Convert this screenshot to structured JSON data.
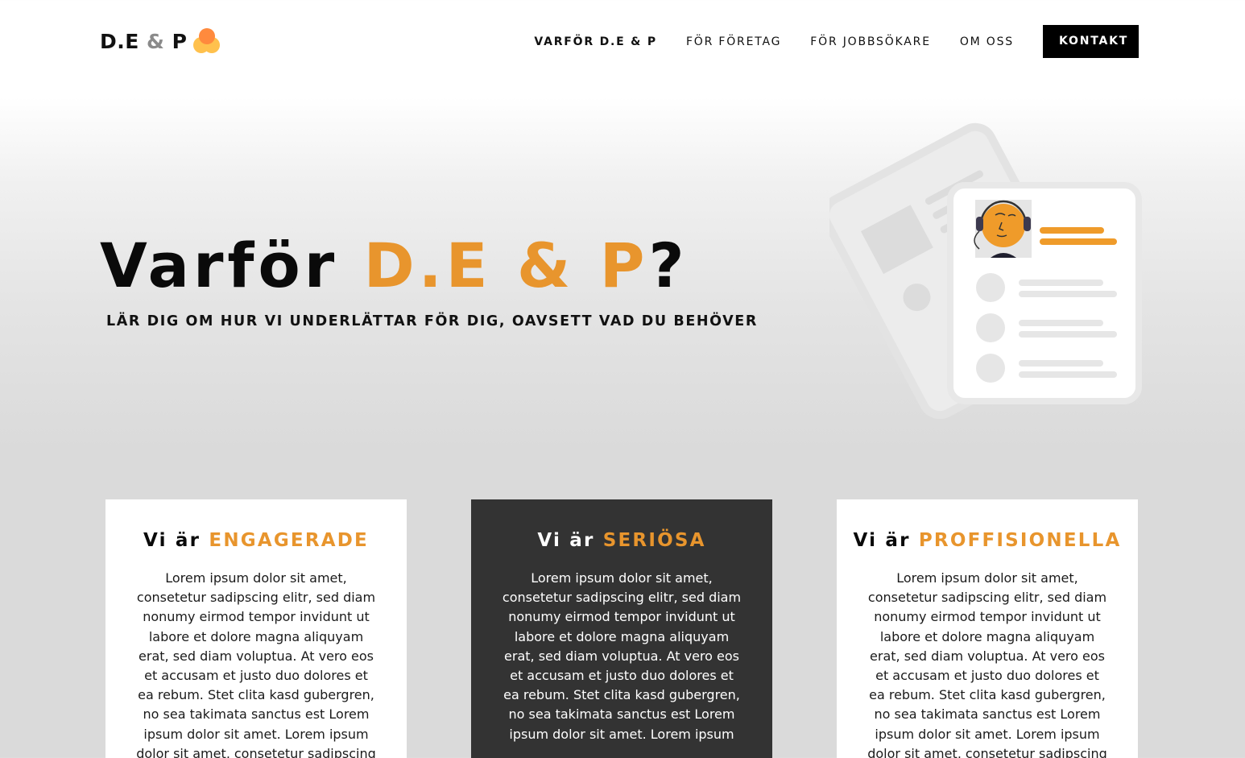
{
  "header": {
    "logo": {
      "part1": "D.E",
      "amp": "&",
      "part2": "P"
    },
    "nav": [
      {
        "label": "VARFÖR D.E & P"
      },
      {
        "label": "FÖR FÖRETAG"
      },
      {
        "label": "FÖR JOBBSÖKARE"
      },
      {
        "label": "OM OSS"
      }
    ],
    "cta_label": "KONTAKT"
  },
  "hero": {
    "title_prefix": "Varför",
    "title_highlight": "D.E & P",
    "title_suffix": "?",
    "subtitle": "LÄR DIG OM HUR VI UNDERLÄTTAR FÖR DIG, OAVSETT VAD DU BEHÖVER"
  },
  "cards": [
    {
      "prefix": "Vi är",
      "highlight": "ENGAGERADE",
      "body": "Lorem ipsum dolor sit amet, consetetur sadipscing elitr, sed diam nonumy eirmod tempor invidunt ut labore et dolore magna aliquyam erat, sed diam voluptua. At vero eos et accusam et justo duo dolores et ea rebum. Stet clita kasd gubergren, no sea takimata sanctus est Lorem ipsum dolor sit amet. Lorem ipsum dolor sit amet, consetetur sadipscing"
    },
    {
      "prefix": "Vi är",
      "highlight": "SERIÖSA",
      "body": "Lorem ipsum dolor sit amet, consetetur sadipscing elitr, sed diam nonumy eirmod tempor invidunt ut labore et dolore magna aliquyam erat, sed diam voluptua. At vero eos et accusam et justo duo dolores et ea rebum. Stet clita kasd gubergren, no sea takimata sanctus est Lorem ipsum dolor sit amet. Lorem ipsum"
    },
    {
      "prefix": "Vi är",
      "highlight": "PROFFISIONELLA",
      "body": "Lorem ipsum dolor sit amet, consetetur sadipscing elitr, sed diam nonumy eirmod tempor invidunt ut labore et dolore magna aliquyam erat, sed diam voluptua. At vero eos et accusam et justo duo dolores et ea rebum. Stet clita kasd gubergren, no sea takimata sanctus est Lorem ipsum dolor sit amet. Lorem ipsum dolor sit amet, consetetur sadipscing"
    }
  ],
  "colors": {
    "accent": "#e8952d",
    "dark_card": "#333333",
    "cta_background": "#000000"
  },
  "icons": {
    "logo": "dep-logo-dots",
    "illustration": "profile-card-with-headset-avatar-icon"
  }
}
